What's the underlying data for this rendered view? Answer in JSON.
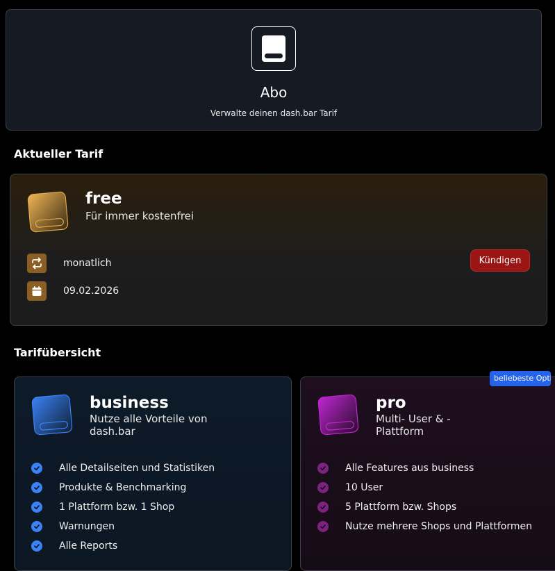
{
  "header": {
    "title": "Abo",
    "subtitle": "Verwalte deinen dash.bar Tarif"
  },
  "current_section": {
    "title": "Aktueller Tarif",
    "plan": {
      "name": "free",
      "description": "Für immer kostenfrei",
      "billing": "monatlich",
      "date": "09.02.2026",
      "cancel_label": "Kündigen"
    }
  },
  "overview_section": {
    "title": "Tarifübersicht",
    "badge": "beliebeste Option",
    "plans": [
      {
        "name": "business",
        "description": "Nutze alle Vorteile von dash.bar",
        "features": [
          "Alle Detailseiten und Statistiken",
          "Produkte & Benchmarking",
          "1 Plattform bzw. 1 Shop",
          "Warnungen",
          "Alle Reports"
        ]
      },
      {
        "name": "pro",
        "description": "Multi- User & -Plattform",
        "features": [
          "Alle Features aus business",
          "10 User",
          "5 Plattform bzw. Shops",
          "Nutze mehrere Shops und Plattformen"
        ]
      }
    ]
  },
  "colors": {
    "free_accent": "#e0a94a",
    "business_accent": "#3b82f6",
    "pro_accent": "#c026d3",
    "cancel": "#9a1514",
    "badge": "#2563eb"
  }
}
